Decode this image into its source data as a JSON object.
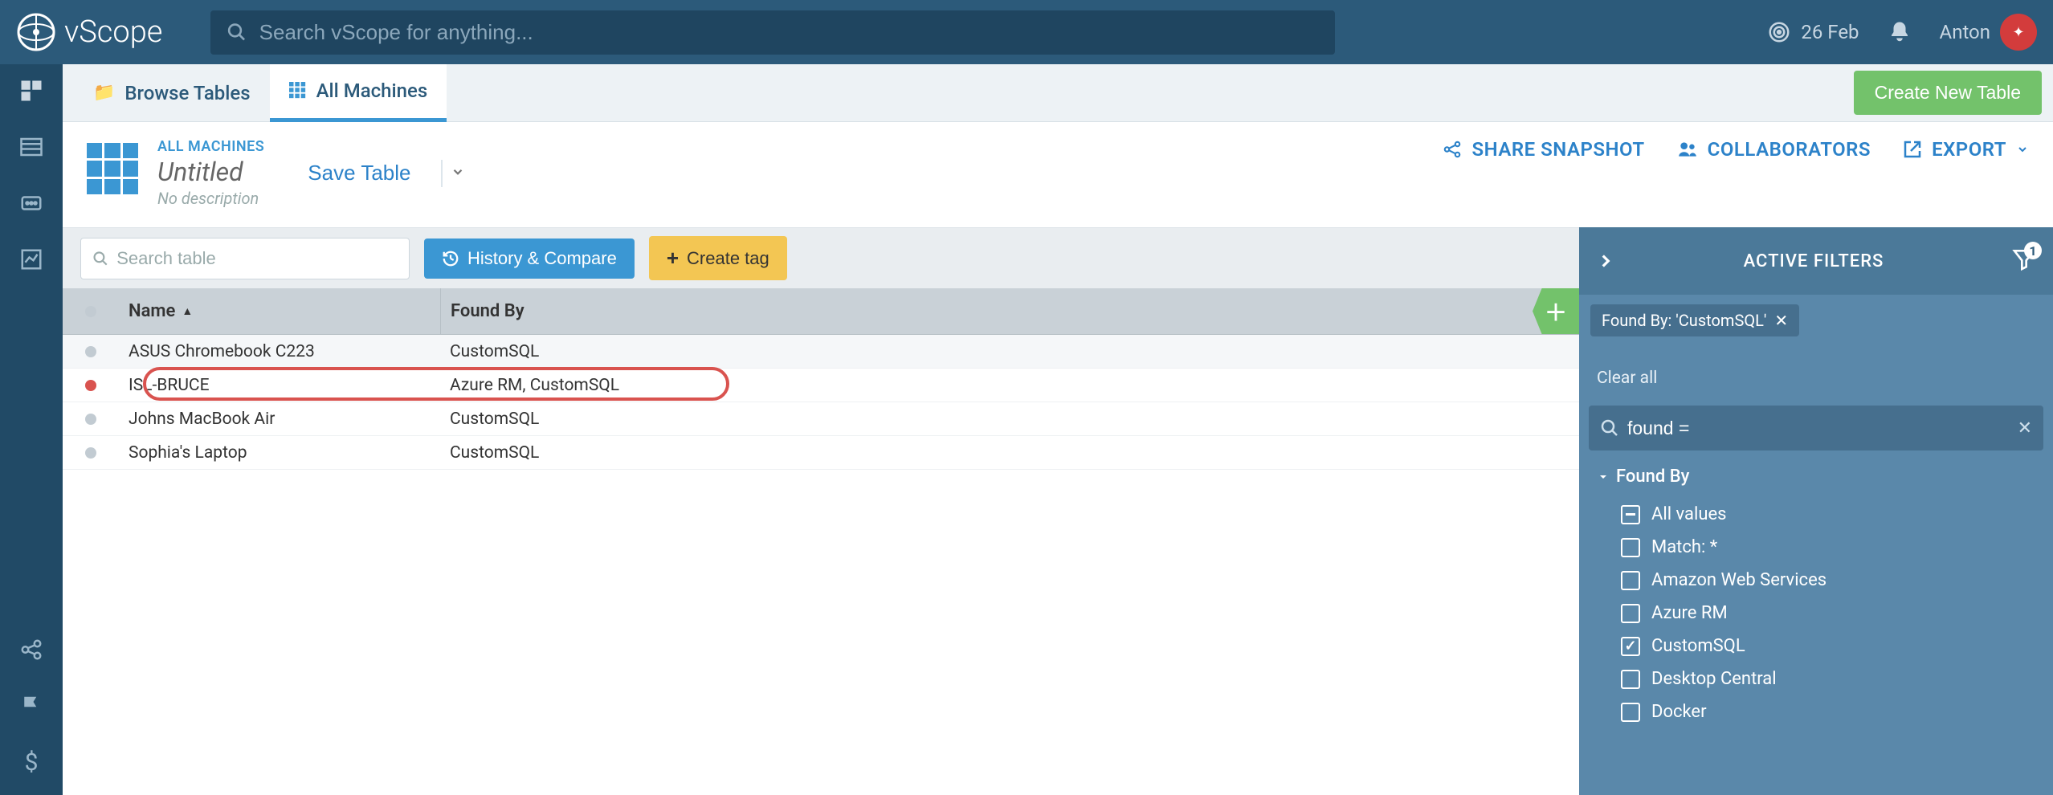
{
  "topbar": {
    "brand": "vScope",
    "search_placeholder": "Search vScope for anything...",
    "date": "26 Feb",
    "user_name": "Anton"
  },
  "tabs": {
    "browse_label": "Browse Tables",
    "all_label": "All Machines",
    "create_button": "Create New Table"
  },
  "page": {
    "breadcrumb": "ALL MACHINES",
    "title": "Untitled",
    "description": "No description",
    "save_label": "Save Table",
    "actions": {
      "share": "SHARE SNAPSHOT",
      "collab": "COLLABORATORS",
      "export": "EXPORT"
    }
  },
  "toolbar": {
    "search_placeholder": "Search table",
    "history_label": "History & Compare",
    "tag_label": "Create tag"
  },
  "table": {
    "columns": {
      "name": "Name",
      "found_by": "Found By"
    },
    "rows": [
      {
        "dot": "grey",
        "name": "ASUS Chromebook C223",
        "found_by": "CustomSQL"
      },
      {
        "dot": "red",
        "name": "ISL-BRUCE",
        "found_by": "Azure RM, CustomSQL",
        "highlighted": true
      },
      {
        "dot": "grey",
        "name": "Johns MacBook Air",
        "found_by": "CustomSQL"
      },
      {
        "dot": "grey",
        "name": "Sophia's Laptop",
        "found_by": "CustomSQL"
      }
    ]
  },
  "filters": {
    "title": "ACTIVE FILTERS",
    "badge_count": "1",
    "chip_label": "Found By: 'CustomSQL'",
    "clear_all": "Clear all",
    "search_value": "found =",
    "group_label": "Found By",
    "options": [
      {
        "label": "All values",
        "state": "indet"
      },
      {
        "label": "Match: *",
        "state": "off"
      },
      {
        "label": "Amazon Web Services",
        "state": "off"
      },
      {
        "label": "Azure RM",
        "state": "off"
      },
      {
        "label": "CustomSQL",
        "state": "checked"
      },
      {
        "label": "Desktop Central",
        "state": "off"
      },
      {
        "label": "Docker",
        "state": "off"
      }
    ]
  }
}
